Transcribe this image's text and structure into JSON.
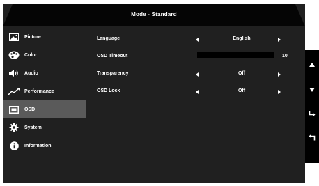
{
  "header": {
    "title": "Mode - Standard"
  },
  "sidebar": {
    "items": [
      {
        "label": "Picture",
        "icon": "picture-icon",
        "selected": false
      },
      {
        "label": "Color",
        "icon": "palette-icon",
        "selected": false
      },
      {
        "label": "Audio",
        "icon": "speaker-icon",
        "selected": false
      },
      {
        "label": "Performance",
        "icon": "trend-icon",
        "selected": false
      },
      {
        "label": "OSD",
        "icon": "osd-screen-icon",
        "selected": true
      },
      {
        "label": "System",
        "icon": "gear-icon",
        "selected": false
      },
      {
        "label": "Information",
        "icon": "info-icon",
        "selected": false
      }
    ]
  },
  "settings": {
    "language": {
      "label": "Language",
      "value": "English"
    },
    "osd_timeout": {
      "label": "OSD Timeout",
      "value": "10"
    },
    "transparency": {
      "label": "Transparency",
      "value": "Off"
    },
    "osd_lock": {
      "label": "OSD Lock",
      "value": "Off"
    }
  },
  "keypad": {
    "keys": [
      "up-arrow-icon",
      "down-arrow-icon",
      "enter-icon",
      "back-icon"
    ]
  },
  "colors": {
    "panel": "#202020",
    "header": "#050505",
    "selected": "#5a5a5a",
    "text": "#ffffff"
  }
}
